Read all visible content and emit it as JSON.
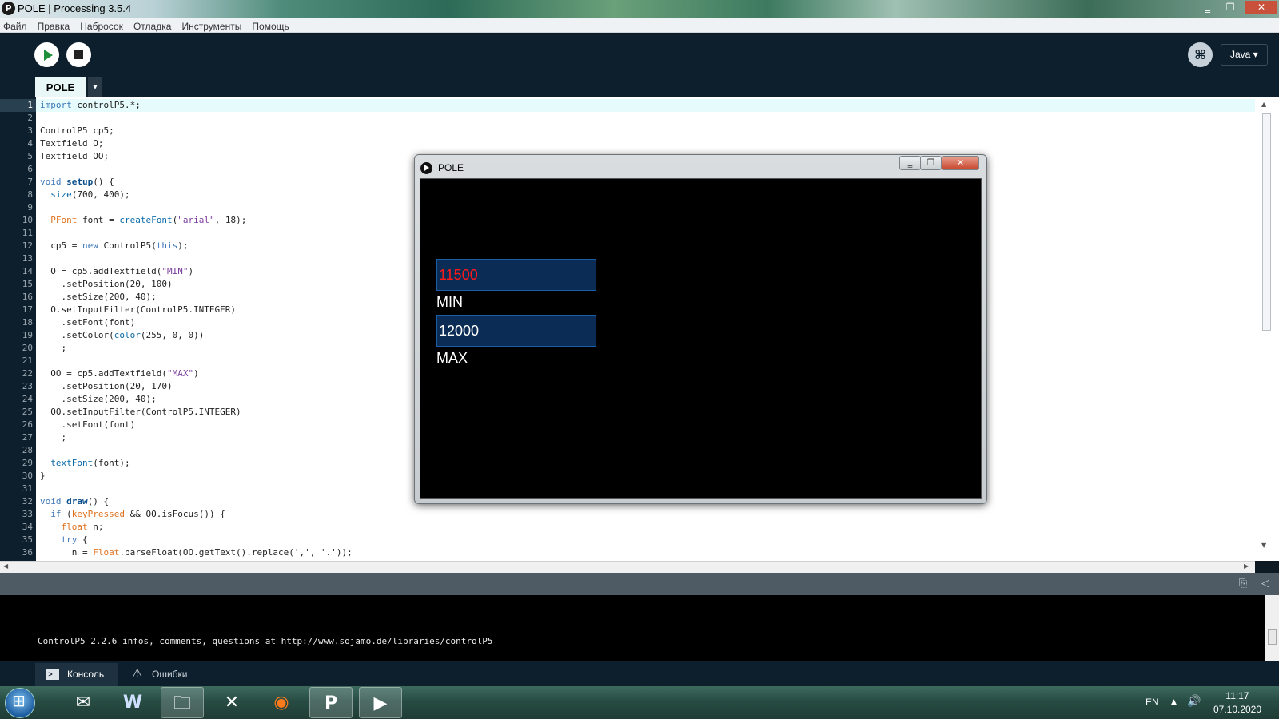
{
  "window": {
    "title": "POLE | Processing 3.5.4",
    "app_icon_glyph": "P",
    "buttons": {
      "minimize": "‗",
      "maximize": "❐",
      "close": "✕"
    }
  },
  "menu": [
    "Файл",
    "Правка",
    "Набросок",
    "Отладка",
    "Инструменты",
    "Помощь"
  ],
  "toolbar": {
    "run_icon": "play-icon",
    "stop_icon": "stop-icon",
    "mode_icon_glyph": "⌘",
    "mode": "Java ▾"
  },
  "tabs": {
    "active": "POLE",
    "menu_glyph": "▾"
  },
  "editor": {
    "line_numbers": [
      "1",
      "2",
      "3",
      "4",
      "5",
      "6",
      "7",
      "8",
      "9",
      "10",
      "11",
      "12",
      "13",
      "14",
      "15",
      "16",
      "17",
      "18",
      "19",
      "20",
      "21",
      "22",
      "23",
      "24",
      "25",
      "26",
      "27",
      "28",
      "29",
      "30",
      "31",
      "32",
      "33",
      "34",
      "35",
      "36"
    ],
    "lines": [
      "import controlP5.*;",
      "",
      "ControlP5 cp5;",
      "Textfield O;",
      "Textfield OO;",
      "",
      "void setup() {",
      "  size(700, 400);",
      "",
      "  PFont font = createFont(\"arial\", 18);",
      "",
      "  cp5 = new ControlP5(this);",
      "",
      "  O = cp5.addTextfield(\"MIN\")",
      "    .setPosition(20, 100)",
      "    .setSize(200, 40);",
      "  O.setInputFilter(ControlP5.INTEGER)",
      "    .setFont(font)",
      "    .setColor(color(255, 0, 0))",
      "    ;",
      "",
      "  OO = cp5.addTextfield(\"MAX\")",
      "    .setPosition(20, 170)",
      "    .setSize(200, 40);",
      "  OO.setInputFilter(ControlP5.INTEGER)",
      "    .setFont(font)",
      "    ;",
      "",
      "  textFont(font);",
      "}",
      "",
      "void draw() {",
      "  if (keyPressed && OO.isFocus()) {",
      "    float n;",
      "    try {",
      "      n = Float.parseFloat(OO.getText().replace(',', '.'));"
    ]
  },
  "console": {
    "text": "ControlP5 2.2.6 infos, comments, questions at http://www.sojamo.de/libraries/controlP5",
    "tab_console": "Консоль",
    "tab_errors": "Ошибки"
  },
  "sketch": {
    "title": "POLE",
    "fields": [
      {
        "label": "MIN",
        "value": "11500",
        "text_color": "#ff1a1a"
      },
      {
        "label": "MAX",
        "value": "12000",
        "text_color": "#ffffff"
      }
    ]
  },
  "taskbar": {
    "items": [
      {
        "name": "outlook-icon",
        "glyph": "✉"
      },
      {
        "name": "word-icon",
        "glyph": "W"
      },
      {
        "name": "explorer-icon",
        "glyph": "🗀"
      },
      {
        "name": "x-app-icon",
        "glyph": "✕"
      },
      {
        "name": "firefox-icon",
        "glyph": "◉"
      },
      {
        "name": "processing-icon",
        "glyph": "P"
      },
      {
        "name": "sketch-run-icon",
        "glyph": "▶"
      }
    ],
    "lang": "EN",
    "time": "11:17",
    "date": "07.10.2020"
  }
}
